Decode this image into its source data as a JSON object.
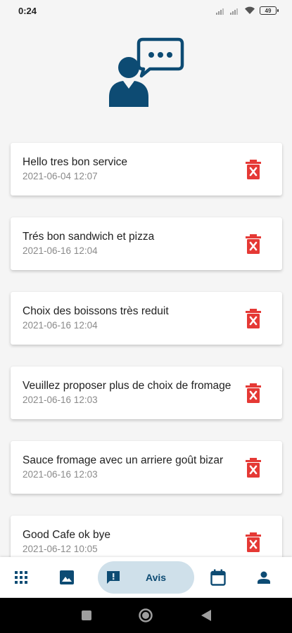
{
  "status_bar": {
    "time": "0:24",
    "battery": "49"
  },
  "colors": {
    "brand": "#0d4b73",
    "delete": "#e53935",
    "active_pill": "#cfe0ea"
  },
  "reviews": [
    {
      "text": "Hello tres bon service",
      "date": "2021-06-04 12:07"
    },
    {
      "text": "Trés bon sandwich et pizza",
      "date": "2021-06-16 12:04"
    },
    {
      "text": "Choix des boissons très reduit",
      "date": "2021-06-16 12:04"
    },
    {
      "text": "Veuillez proposer plus de choix de fromage",
      "date": "2021-06-16 12:03"
    },
    {
      "text": "Sauce fromage avec un arriere goût bizar",
      "date": "2021-06-16 12:03"
    },
    {
      "text": "Good Cafe ok bye",
      "date": "2021-06-12 10:05"
    }
  ],
  "bottom_nav": {
    "items": [
      {
        "icon": "apps-grid-icon"
      },
      {
        "icon": "image-icon"
      },
      {
        "icon": "feedback-icon",
        "label": "Avis",
        "active": true
      },
      {
        "icon": "calendar-icon"
      },
      {
        "icon": "person-icon"
      }
    ]
  },
  "system_nav": [
    "recents-icon",
    "home-icon",
    "back-icon"
  ]
}
